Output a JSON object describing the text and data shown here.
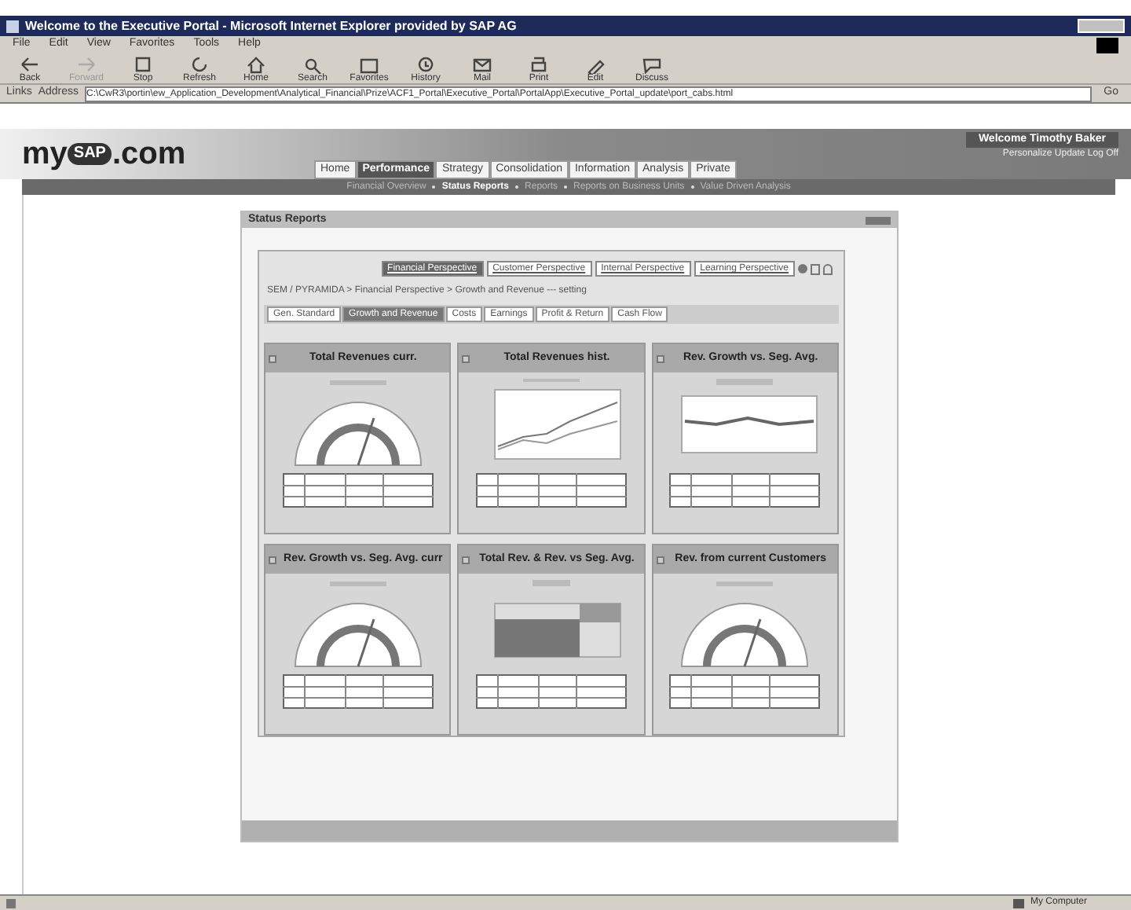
{
  "window": {
    "title": "Welcome to the Executive Portal - Microsoft Internet Explorer provided by SAP AG"
  },
  "menu": [
    "File",
    "Edit",
    "View",
    "Favorites",
    "Tools",
    "Help"
  ],
  "toolbar": [
    {
      "label": "Back",
      "kind": "back",
      "disabled": false
    },
    {
      "label": "Forward",
      "kind": "forward",
      "disabled": true
    },
    {
      "label": "Stop",
      "kind": "stop",
      "disabled": false
    },
    {
      "label": "Refresh",
      "kind": "refresh",
      "disabled": false
    },
    {
      "label": "Home",
      "kind": "home",
      "disabled": false
    },
    {
      "label": "Search",
      "kind": "search",
      "disabled": false
    },
    {
      "label": "Favorites",
      "kind": "favorites",
      "disabled": false
    },
    {
      "label": "History",
      "kind": "history",
      "disabled": false
    },
    {
      "label": "Mail",
      "kind": "mail",
      "disabled": false
    },
    {
      "label": "Print",
      "kind": "print",
      "disabled": false
    },
    {
      "label": "Edit",
      "kind": "edit",
      "disabled": false
    },
    {
      "label": "Discuss",
      "kind": "discuss",
      "disabled": false
    }
  ],
  "address_bar": {
    "links": "Links",
    "label": "Address",
    "value": "C:\\CwR3\\portin\\ew_Application_Development\\Analytical_Financial\\Prize\\ACF1_Portal\\Executive_Portal\\PortalApp\\Executive_Portal_update\\port_cabs.html",
    "go": "Go"
  },
  "portal_header": {
    "logo_left": "my",
    "logo_badge": "SAP",
    "logo_right": ".com",
    "welcome": "Welcome  Timothy Baker",
    "links": "Personalize  Update  Log Off"
  },
  "tabs": [
    {
      "label": "Home",
      "selected": false
    },
    {
      "label": "Performance",
      "selected": true
    },
    {
      "label": "Strategy",
      "selected": false
    },
    {
      "label": "Consolidation",
      "selected": false
    },
    {
      "label": "Information",
      "selected": false
    },
    {
      "label": "Analysis",
      "selected": false
    },
    {
      "label": "Private",
      "selected": false
    }
  ],
  "subnav": [
    {
      "label": "Financial Overview",
      "selected": false
    },
    {
      "label": "Status Reports",
      "selected": true
    },
    {
      "label": "Reports",
      "selected": false
    },
    {
      "label": "Reports on Business Units",
      "selected": false
    },
    {
      "label": "Value Driven Analysis",
      "selected": false
    }
  ],
  "portlet": {
    "title": "Status Reports",
    "perspective_tabs": [
      {
        "label": "Financial Perspective",
        "selected": true
      },
      {
        "label": "Customer Perspective",
        "selected": false
      },
      {
        "label": "Internal Perspective",
        "selected": false
      },
      {
        "label": "Learning Perspective",
        "selected": false
      }
    ],
    "breadcrumb": "SEM / PYRAMIDA > Financial Perspective > Growth and Revenue --- setting",
    "subtabs": [
      {
        "label": "Gen. Standard",
        "selected": false
      },
      {
        "label": "Growth and Revenue",
        "selected": true
      },
      {
        "label": "Costs",
        "selected": false
      },
      {
        "label": "Earnings",
        "selected": false
      },
      {
        "label": "Profit & Return",
        "selected": false
      },
      {
        "label": "Cash Flow",
        "selected": false
      }
    ],
    "cards": [
      {
        "title": "Total Revenues curr.",
        "kind": "gauge"
      },
      {
        "title": "Total Revenues hist.",
        "kind": "line"
      },
      {
        "title": "Rev. Growth vs. Seg. Avg.",
        "kind": "flatline"
      },
      {
        "title": "Rev. Growth vs. Seg. Avg. curr",
        "kind": "gauge"
      },
      {
        "title": "Total Rev. & Rev. vs Seg. Avg.",
        "kind": "bar"
      },
      {
        "title": "Rev. from current Customers",
        "kind": "gauge"
      }
    ]
  },
  "status_bar": {
    "zone": "My Computer"
  }
}
